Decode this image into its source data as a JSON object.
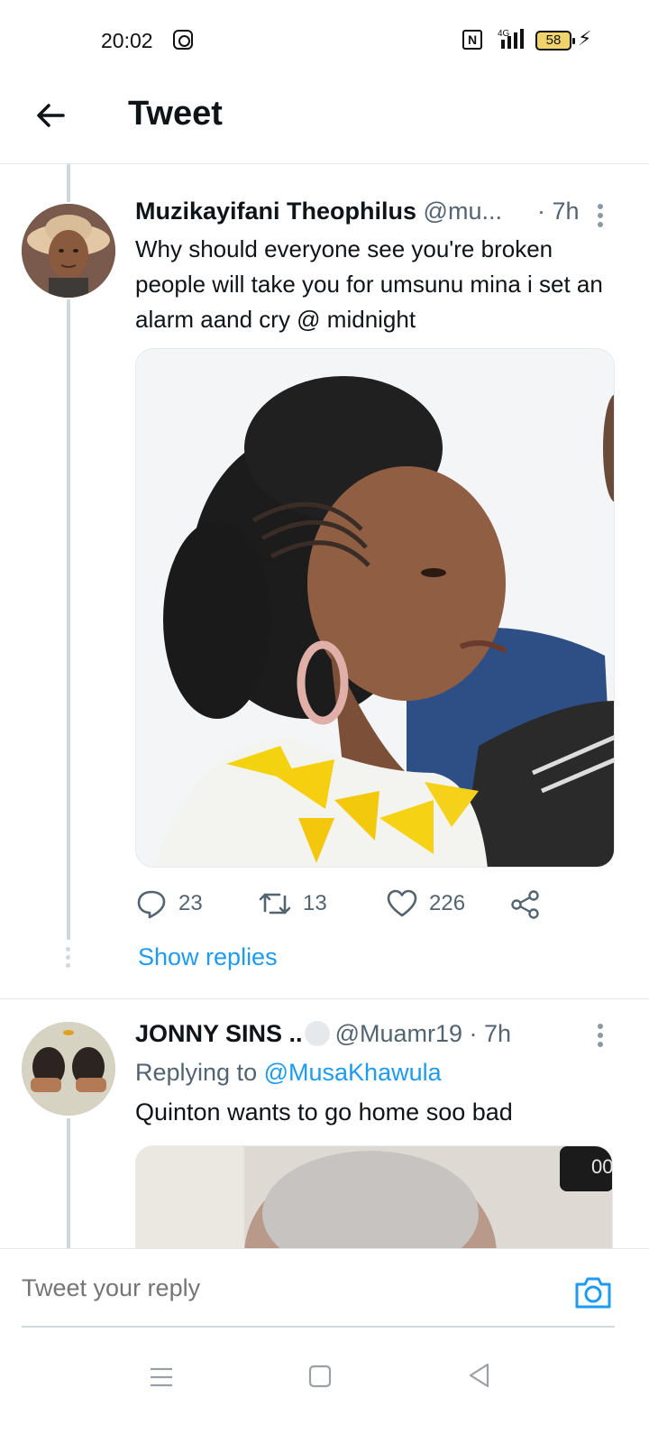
{
  "status_bar": {
    "time": "20:02",
    "network": "4G",
    "battery": "58",
    "icons": [
      "instagram-icon",
      "nfc-icon",
      "signal-icon",
      "battery-icon",
      "charging-icon"
    ]
  },
  "header": {
    "title": "Tweet",
    "back_icon": "arrow-left-icon"
  },
  "tweet1": {
    "name": "Muzikayifani Theophilus",
    "handle": "@mu...",
    "time": "· 7h",
    "text": "Why should everyone see you're broken people will take you for umsunu mina i set an alarm aand cry @ midnight",
    "actions": {
      "replies": "23",
      "retweets": "13",
      "likes": "226"
    },
    "show_replies": "Show replies"
  },
  "tweet2": {
    "name": "JONNY SINS ..",
    "handle": "@Muamr19",
    "time": "· 7h",
    "replying_prefix": "Replying to",
    "replying_to": "@MusaKhawula",
    "text": "Quinton wants to go home soo bad",
    "media_badge": "00"
  },
  "reply_bar": {
    "placeholder": "Tweet your reply"
  },
  "colors": {
    "accent": "#1d9bf0",
    "secondary_text": "#536471",
    "primary_text": "#0f1419",
    "divider": "#e6e9eb"
  }
}
